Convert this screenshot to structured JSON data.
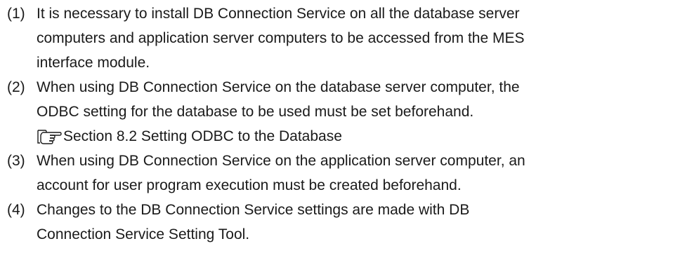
{
  "items": [
    {
      "number": "(1)",
      "lines": [
        "It is necessary to install DB Connection Service on all the database server",
        "computers and application server computers to be accessed from the MES",
        "interface module."
      ]
    },
    {
      "number": "(2)",
      "lines": [
        "When using DB Connection Service on the database server computer, the",
        "ODBC setting for the database to be used must be set beforehand."
      ],
      "reference": {
        "icon": "pointing-hand-icon",
        "text": "Section 8.2 Setting ODBC to the Database"
      }
    },
    {
      "number": "(3)",
      "lines": [
        "When using DB Connection Service on the application server computer, an",
        "account for user program execution must be created beforehand."
      ]
    },
    {
      "number": "(4)",
      "lines": [
        "Changes to the DB Connection Service settings are made with DB",
        "Connection Service Setting Tool."
      ]
    }
  ]
}
